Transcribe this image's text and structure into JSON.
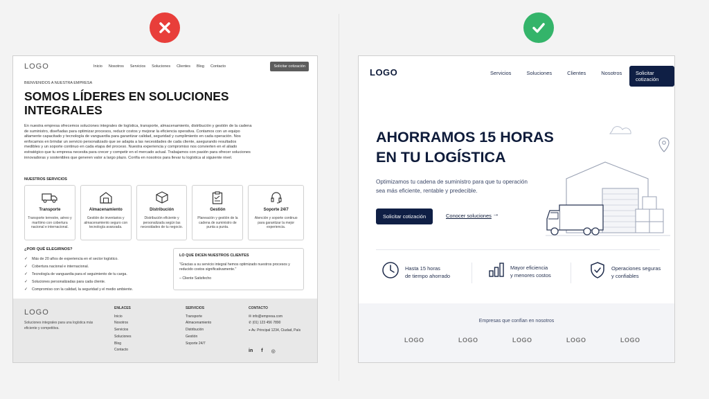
{
  "badges": {
    "bad": "cross-icon",
    "good": "check-icon",
    "colors": {
      "bad": "#e83e3a",
      "good": "#34b46a"
    }
  },
  "left": {
    "logo": "LOGO",
    "nav": [
      "Inicio",
      "Nosotros",
      "Servicios",
      "Soluciones",
      "Clientes",
      "Blog",
      "Contacto"
    ],
    "cta": "Solicitar cotización",
    "kicker": "BIENVENIDOS A NUESTRA EMPRESA",
    "title": "SOMOS LÍDERES EN SOLUCIONES INTEGRALES",
    "body": "En nuestra empresa ofrecemos soluciones integrales de logística, transporte, almacenamiento, distribución y gestión de la cadena de suministro, diseñadas para optimizar procesos, reducir costos y mejorar la eficiencia operativa. Contamos con un equipo altamente capacitado y tecnología de vanguardia para garantizar calidad, seguridad y cumplimiento en cada operación. Nos enfocamos en brindar un servicio personalizado que se adapta a las necesidades de cada cliente, asegurando resultados medibles y un soporte continuo en cada etapa del proceso. Nuestra experiencia y compromiso nos convierten en el aliado estratégico que tu empresa necesita para crecer y competir en el mercado actual. Trabajamos con pasión para ofrecer soluciones innovadoras y sostenibles que generen valor a largo plazo. Confía en nosotros para llevar tu logística al siguiente nivel.",
    "services_heading": "NUESTROS SERVICIOS",
    "services": [
      {
        "title": "Transporte",
        "desc": "Transporte terrestre, aéreo y marítimo con cobertura nacional e internacional.",
        "icon": "truck-icon"
      },
      {
        "title": "Almacenamiento",
        "desc": "Gestión de inventarios y almacenamiento seguro con tecnología avanzada.",
        "icon": "warehouse-icon"
      },
      {
        "title": "Distribución",
        "desc": "Distribución eficiente y personalizada según las necesidades de tu negocio.",
        "icon": "box-icon"
      },
      {
        "title": "Gestión",
        "desc": "Planeación y gestión de la cadena de suministro de punta a punta.",
        "icon": "clipboard-icon"
      },
      {
        "title": "Soporte 24/7",
        "desc": "Atención y soporte continuo para garantizar la mejor experiencia.",
        "icon": "headset-icon"
      }
    ],
    "why_heading": "¿POR QUÉ ELEGIRNOS?",
    "why": [
      "Más de 20 años de experiencia en el sector logístico.",
      "Cobertura nacional e internacional.",
      "Tecnología de vanguardia para el seguimiento de tu carga.",
      "Soluciones personalizadas para cada cliente.",
      "Compromiso con la calidad, la seguridad y el medio ambiente."
    ],
    "testimonial": {
      "heading": "LO QUE DICEN NUESTROS CLIENTES",
      "quote": "\"Gracias a su servicio integral hemos optimizado nuestros procesos y reducido costos significativamente.\"",
      "author": "– Cliente Satisfecho"
    },
    "footer": {
      "logo": "LOGO",
      "tagline": "Soluciones integrales para una logística más eficiente y competitiva.",
      "links_heading": "ENLACES",
      "links": [
        "Inicio",
        "Nosotros",
        "Servicios",
        "Soluciones",
        "Blog",
        "Contacto"
      ],
      "services_heading": "SERVICIOS",
      "services": [
        "Transporte",
        "Almacenamiento",
        "Distribución",
        "Gestión",
        "Soporte 24/7"
      ],
      "contact_heading": "CONTACTO",
      "email": "info@empresa.com",
      "phone": "(01) 123 456 7890",
      "address": "Av. Principal 1234, Ciudad, País",
      "social": [
        "in",
        "f",
        "◎"
      ]
    }
  },
  "right": {
    "logo": "LOGO",
    "nav": [
      "Servicios",
      "Soluciones",
      "Clientes",
      "Nosotros"
    ],
    "cta": "Solicitar cotización",
    "title_line1": "AHORRAMOS 15 HORAS",
    "title_line2": "EN TU LOGÍSTICA",
    "subtitle": "Optimizamos tu cadena de suministro para que tu operación sea más eficiente, rentable y predecible.",
    "primary_button": "Solicitar cotización",
    "secondary_link": "Conocer soluciones",
    "features": [
      {
        "line1": "Hasta 15 horas",
        "line2": "de tiempo ahorrado",
        "icon": "clock-icon"
      },
      {
        "line1": "Mayor eficiencia",
        "line2": "y menores costos",
        "icon": "bar-chart-icon"
      },
      {
        "line1": "Operaciones seguras",
        "line2": "y confiables",
        "icon": "shield-check-icon"
      }
    ],
    "trust_heading": "Empresas que confían en nosotros",
    "trust_logos": [
      "LOGO",
      "LOGO",
      "LOGO",
      "LOGO",
      "LOGO"
    ],
    "colors": {
      "navy": "#0f1f45"
    }
  }
}
